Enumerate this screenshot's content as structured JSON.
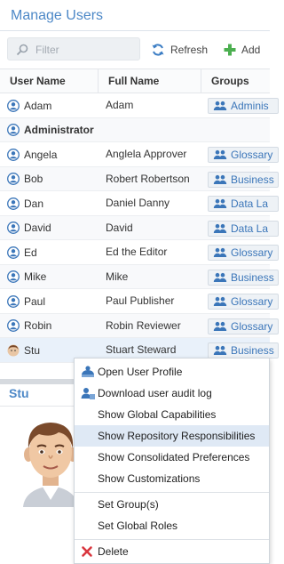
{
  "header": {
    "title": "Manage Users"
  },
  "toolbar": {
    "filter_placeholder": "Filter",
    "refresh_label": "Refresh",
    "add_label": "Add"
  },
  "table": {
    "columns": [
      "User Name",
      "Full Name",
      "Groups"
    ],
    "rows": [
      {
        "user": "Adam",
        "full": "Adam",
        "group": "Adminis"
      },
      {
        "user": "Administrator",
        "full": "",
        "group": ""
      },
      {
        "user": "Angela",
        "full": "Anglela Approver",
        "group": "Glossary"
      },
      {
        "user": "Bob",
        "full": "Robert Robertson",
        "group": "Business"
      },
      {
        "user": "Dan",
        "full": "Daniel Danny",
        "group": "Data La"
      },
      {
        "user": "David",
        "full": "David",
        "group": "Data La"
      },
      {
        "user": "Ed",
        "full": "Ed the Editor",
        "group": "Glossary"
      },
      {
        "user": "Mike",
        "full": "Mike",
        "group": "Business"
      },
      {
        "user": "Paul",
        "full": "Paul Publisher",
        "group": "Glossary"
      },
      {
        "user": "Robin",
        "full": "Robin Reviewer",
        "group": "Glossary"
      },
      {
        "user": "Stu",
        "full": "Stuart Steward",
        "group": "Business"
      }
    ]
  },
  "detail": {
    "title": "Stu"
  },
  "context_menu": {
    "items": [
      "Open User Profile",
      "Download user audit log",
      "Show Global Capabilities",
      "Show Repository Responsibilities",
      "Show Consolidated Preferences",
      "Show Customizations",
      "Set Group(s)",
      "Set Global Roles",
      "Delete"
    ],
    "hovered_item": "Show Repository Responsibilities"
  },
  "colors": {
    "accent": "#4d88c7",
    "add_green": "#4caf50",
    "delete_red": "#d9363e",
    "menu_hover": "#dfe9f5"
  }
}
